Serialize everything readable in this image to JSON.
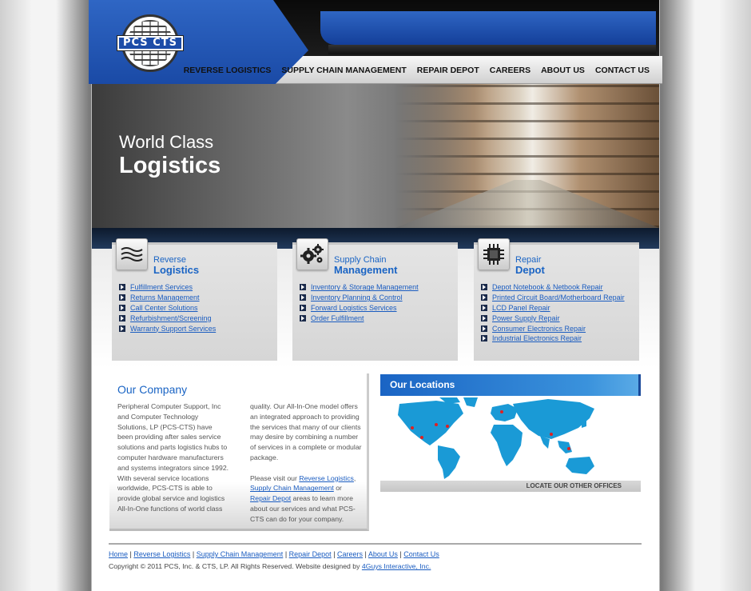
{
  "brand": {
    "logo_text": "PCS CTS"
  },
  "nav": [
    "REVERSE LOGISTICS",
    "SUPPLY CHAIN MANAGEMENT",
    "REPAIR DEPOT",
    "CAREERS",
    "ABOUT US",
    "CONTACT US"
  ],
  "hero": {
    "line1": "World Class",
    "line2": "Logistics"
  },
  "services": [
    {
      "title1": "Reverse",
      "title2": "Logistics",
      "icon": "waves-icon",
      "links": [
        "Fulfillment Services",
        "Returns Management",
        "Call Center Solutions",
        "Refurbishment/Screening",
        "Warranty Support Services"
      ]
    },
    {
      "title1": "Supply Chain",
      "title2": "Management",
      "icon": "gears-icon",
      "links": [
        "Inventory & Storage Management",
        "Inventory Planning & Control",
        "Forward Logistics Services",
        "Order Fulfillment"
      ]
    },
    {
      "title1": "Repair",
      "title2": "Depot",
      "icon": "chip-icon",
      "links": [
        "Depot Notebook & Netbook Repair",
        "Printed Circuit Board/Motherboard Repair",
        "LCD Panel Repair",
        "Power Supply Repair",
        "Consumer Electronics Repair",
        "Industrial Electronics Repair"
      ]
    }
  ],
  "company": {
    "heading": "Our Company",
    "col1": "Peripheral Computer Support, Inc and Computer Technology Solutions, LP (PCS-CTS) have been providing after sales service solutions and parts logistics hubs to computer hardware manufacturers and systems integrators since 1992. With several service locations worldwide, PCS-CTS is able to provide global service and logistics All-In-One functions of world class",
    "col2_p1": "quality. Our All-In-One model offers an integrated approach to providing the services that many of our clients may desire by combining a number of services in a complete or modular package.",
    "col2_p2_start": "Please visit our ",
    "link_rl": "Reverse Logistics",
    "sep1": ",",
    "link_scm": "Supply Chain Management",
    "sep2": " or",
    "link_rd": "Repair Depot",
    "col2_p2_end": " areas to learn more about our services and what PCS-CTS can do for your company."
  },
  "locations": {
    "heading": "Our Locations",
    "footer": "LOCATE OUR OTHER OFFICES"
  },
  "footer": {
    "links": [
      "Home",
      "Reverse Logistics",
      "Supply Chain Management",
      "Repair Depot",
      "Careers",
      "About Us",
      "Contact Us"
    ],
    "copyright": "Copyright © 2011 PCS, Inc. & CTS, LP. All Rights Reserved. Website designed by ",
    "designer": "4Guys Interactive, Inc."
  },
  "colors": {
    "accent": "#1a64c4",
    "link": "#1a5cc0",
    "header_blue": "#2f66c4"
  }
}
